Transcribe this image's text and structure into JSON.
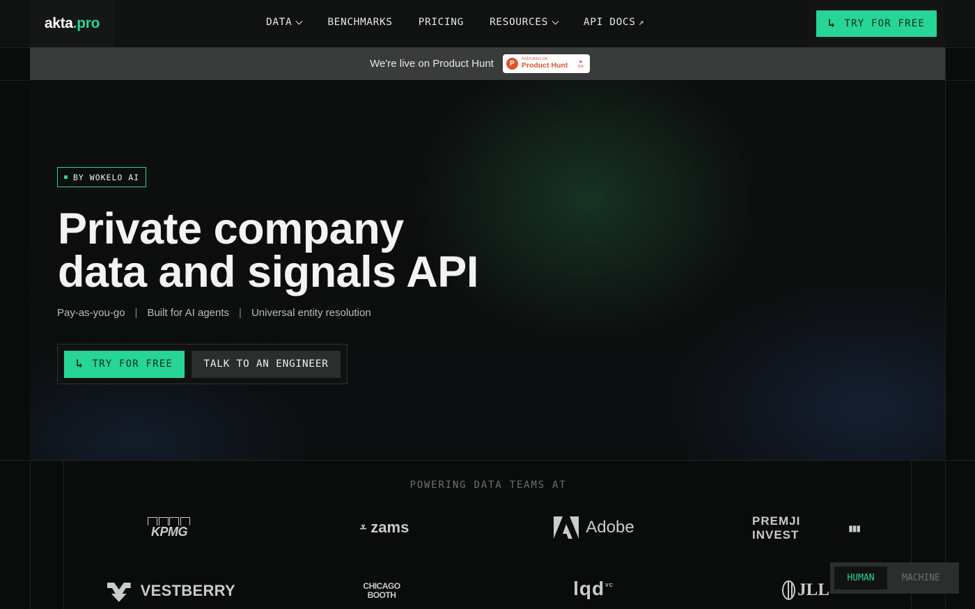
{
  "brand": {
    "name_part1": "akta",
    "name_part2": ".pro",
    "accent_color": "#27d597"
  },
  "nav": {
    "items": [
      {
        "label": "DATA",
        "has_dropdown": true
      },
      {
        "label": "BENCHMARKS",
        "has_dropdown": false
      },
      {
        "label": "PRICING",
        "has_dropdown": false
      },
      {
        "label": "RESOURCES",
        "has_dropdown": true
      },
      {
        "label": "API DOCS",
        "external": true
      }
    ],
    "cta_label": "TRY FOR FREE"
  },
  "banner": {
    "text": "We're live on Product Hunt",
    "badge": {
      "small": "FEATURED ON",
      "name": "Product Hunt",
      "logo_letter": "P",
      "votes": "304"
    }
  },
  "hero": {
    "tag": "BY WOKELO AI",
    "title_line1": "Private company",
    "title_line2": "data and signals API",
    "features": [
      "Pay-as-you-go",
      "Built for AI agents",
      "Universal entity resolution"
    ],
    "separator": "|",
    "primary_cta": "TRY FOR FREE",
    "secondary_cta": "TALK TO AN ENGINEER"
  },
  "logos": {
    "heading": "POWERING DATA TEAMS AT",
    "kpmg": "KPMG",
    "zams": "zams",
    "adobe": "Adobe",
    "premji": "PREMJI INVEST",
    "vestberry": "VESTBERRY",
    "chicago_line1": "CHICAGO",
    "chicago_line2": "BOOTH",
    "lqd": "lqd",
    "lqd_sup": "VC",
    "jll": "JLL"
  },
  "toggle": {
    "on_label": "HUMAN",
    "off_label": "MACHINE"
  }
}
